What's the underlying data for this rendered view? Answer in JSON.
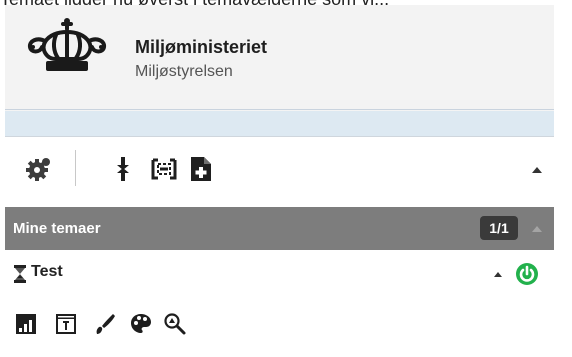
{
  "document": {
    "top_text": "Temaet ligger nu øverst i temavælgerne som vi..."
  },
  "header": {
    "org_name": "Miljøministeriet",
    "org_sub": "Miljøstyrelsen"
  },
  "toolbar": {
    "icons": [
      "settings-gear-icon",
      "expand-collapse-icon",
      "select-area-icon",
      "add-document-icon",
      "collapse-caret-icon"
    ]
  },
  "themes_section": {
    "title": "Mine temaer",
    "count": "1/1"
  },
  "theme_item": {
    "name": "Test",
    "status_color": "#22b14c"
  },
  "theme_tools": {
    "icons": [
      "signal-bars-icon",
      "text-box-icon",
      "brush-icon",
      "palette-icon",
      "zoom-to-icon"
    ]
  }
}
